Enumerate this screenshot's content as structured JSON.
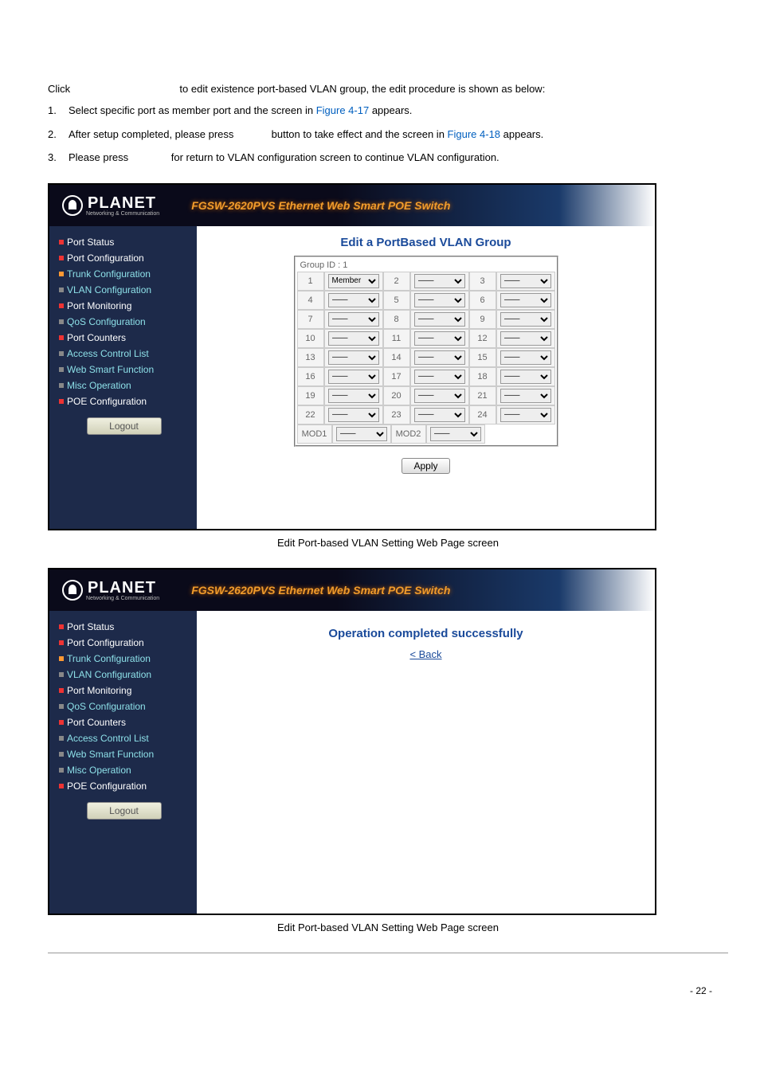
{
  "intro": {
    "click_pre": "Click",
    "click_post": "to edit existence port-based VLAN group, the edit procedure is shown as below:",
    "step1_pre": "Select specific port as member port and the screen in ",
    "fig417": "Figure 4-17",
    "step1_post": " appears.",
    "step2_pre": "After setup completed, please press ",
    "step2_mid": " button to take effect and the screen in ",
    "fig418": "Figure 4-18",
    "step2_post": " appears.",
    "step3_pre": "Please press ",
    "step3_post": "for return to VLAN configuration screen to continue VLAN configuration.",
    "n1": "1.",
    "n2": "2.",
    "n3": "3."
  },
  "header": {
    "brand": "PLANET",
    "sub": "Networking & Communication",
    "title": "FGSW-2620PVS Ethernet Web Smart POE Switch"
  },
  "nav": {
    "items": [
      {
        "label": "Port Status",
        "cls": "red"
      },
      {
        "label": "Port Configuration",
        "cls": "red"
      },
      {
        "label": "Trunk Configuration",
        "cls": "orange"
      },
      {
        "label": "VLAN Configuration",
        "cls": "gray"
      },
      {
        "label": "Port Monitoring",
        "cls": "red"
      },
      {
        "label": "QoS Configuration",
        "cls": "gray"
      },
      {
        "label": "Port Counters",
        "cls": "red"
      },
      {
        "label": "Access Control List",
        "cls": "gray"
      },
      {
        "label": "Web Smart Function",
        "cls": "gray"
      },
      {
        "label": "Misc Operation",
        "cls": "gray"
      },
      {
        "label": "POE Configuration",
        "cls": "red"
      }
    ],
    "logout": "Logout"
  },
  "edit_screen": {
    "title": "Edit a PortBased VLAN Group",
    "group_id": "Group ID : 1",
    "member_opt": "Member",
    "dash_opt": "——",
    "apply": "Apply",
    "mod1": "MOD1",
    "mod2": "MOD2",
    "ports": [
      "1",
      "2",
      "3",
      "4",
      "5",
      "6",
      "7",
      "8",
      "9",
      "10",
      "11",
      "12",
      "13",
      "14",
      "15",
      "16",
      "17",
      "18",
      "19",
      "20",
      "21",
      "22",
      "23",
      "24"
    ]
  },
  "caption1": "Edit Port-based VLAN Setting Web Page screen",
  "success_screen": {
    "title": "Operation completed successfully",
    "back": "< Back"
  },
  "caption2": "Edit Port-based VLAN Setting Web Page screen",
  "page_num": "- 22 -"
}
